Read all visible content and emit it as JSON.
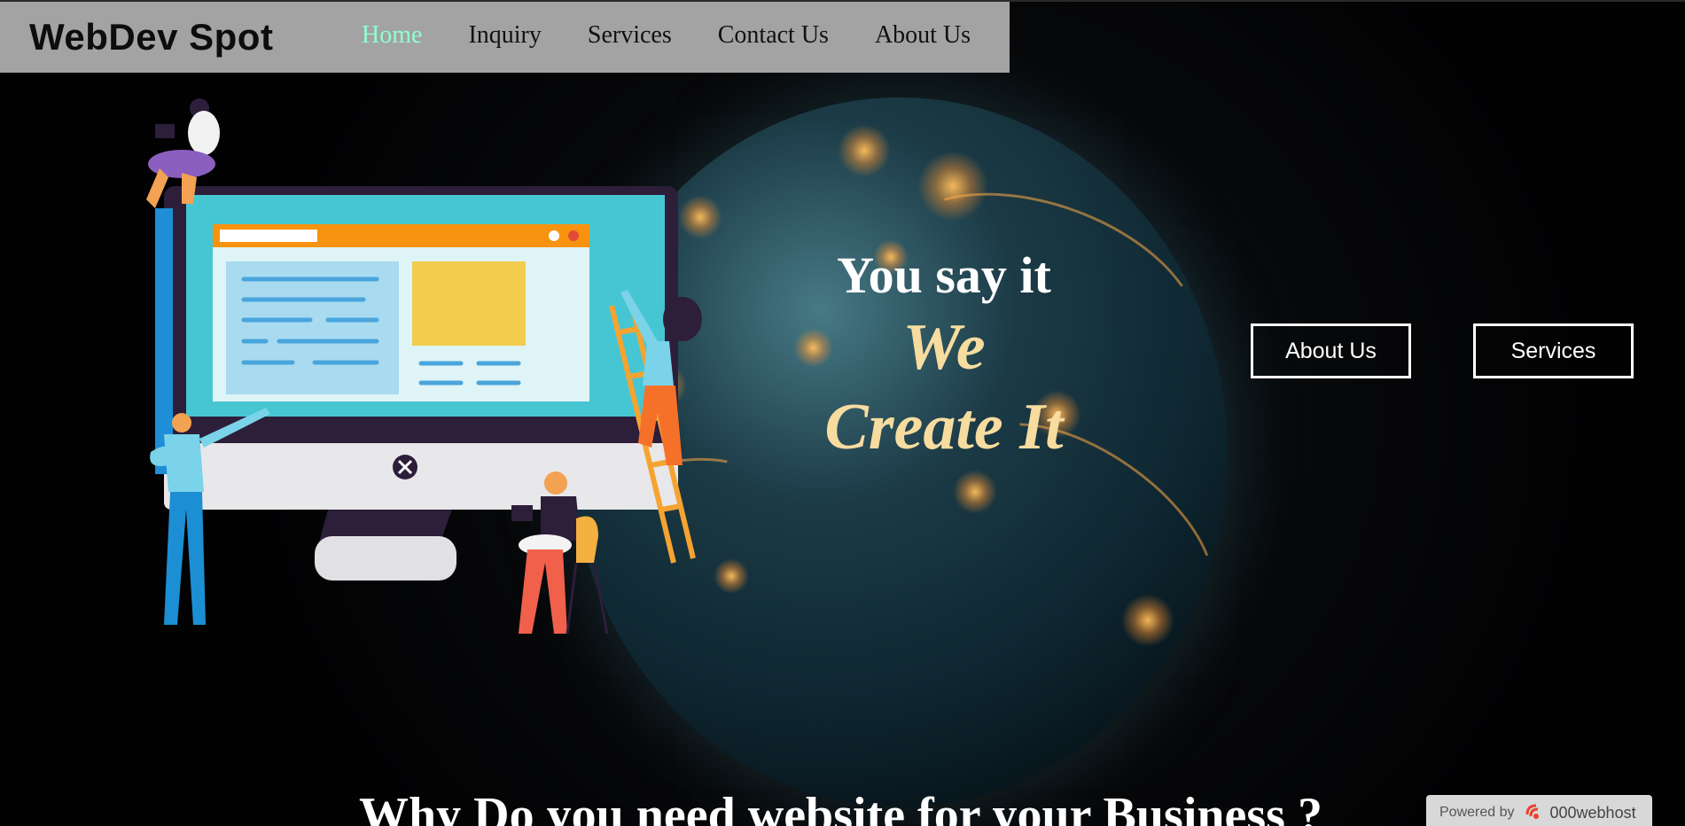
{
  "brand": {
    "name": "WebDev Spot"
  },
  "nav": {
    "items": [
      {
        "label": "Home",
        "active": true
      },
      {
        "label": "Inquiry",
        "active": false
      },
      {
        "label": "Services",
        "active": false
      },
      {
        "label": "Contact Us",
        "active": false
      },
      {
        "label": "About Us",
        "active": false
      }
    ]
  },
  "hero": {
    "line1": "You say it",
    "line2": "We",
    "line3": "Create It",
    "buttons": {
      "about": "About Us",
      "services": "Services"
    }
  },
  "section": {
    "heading": "Why Do you need website for your Business ?"
  },
  "badge": {
    "powered_by": "Powered by",
    "host": "000webhost"
  },
  "icons": {
    "monitor": "computer-monitor-illustration",
    "host_logo": "000webhost-logo-icon"
  },
  "colors": {
    "nav_bg": "#a3a3a3",
    "active_link": "#8fffd0",
    "hero_accent": "#f7dca0",
    "monitor_screen": "#46c6d2",
    "browser_bar": "#f7930e"
  }
}
